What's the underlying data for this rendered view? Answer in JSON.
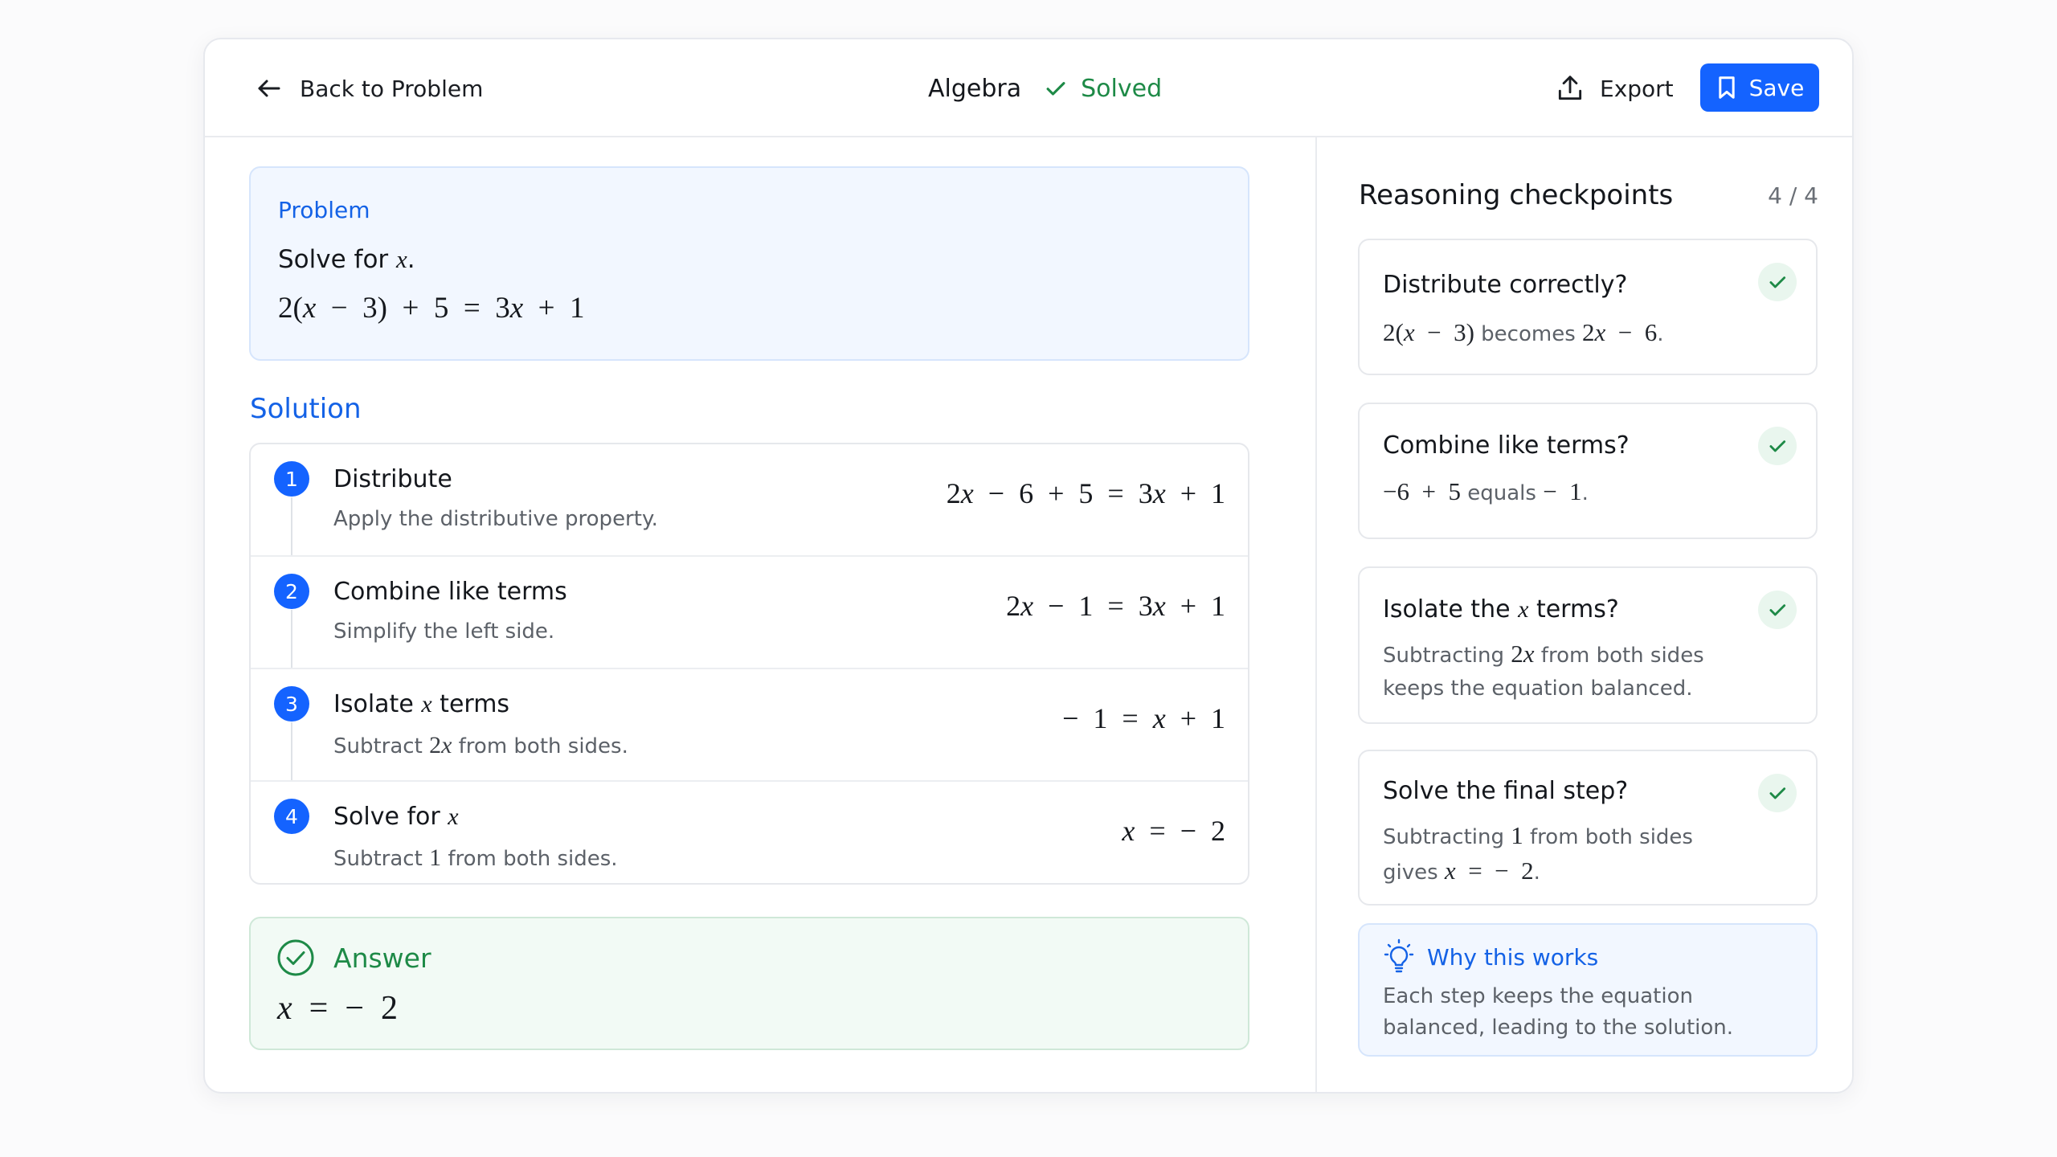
{
  "header": {
    "back_label": "Back to Problem",
    "subject": "Algebra",
    "status": "Solved",
    "export_label": "Export",
    "save_label": "Save"
  },
  "problem": {
    "label": "Problem",
    "instruction_prefix": "Solve for ",
    "instruction_var": "x",
    "instruction_suffix": ".",
    "equation": "2(x − 3) + 5 = 3x + 1"
  },
  "solution": {
    "heading": "Solution",
    "steps": [
      {
        "number": "1",
        "title": "Distribute",
        "description": "Apply the distributive property.",
        "equation": "2x − 6 + 5 = 3x + 1"
      },
      {
        "number": "2",
        "title": "Combine like terms",
        "description": "Simplify the left side.",
        "equation": "2x − 1 = 3x + 1"
      },
      {
        "number": "3",
        "title_prefix": "Isolate ",
        "title_var": "x",
        "title_suffix": " terms",
        "desc_prefix": "Subtract ",
        "desc_math": "2x",
        "desc_suffix": " from both sides.",
        "equation": "− 1 = x + 1"
      },
      {
        "number": "4",
        "title_prefix": "Solve for ",
        "title_var": "x",
        "desc_prefix": "Subtract ",
        "desc_math": "1",
        "desc_suffix": " from both sides.",
        "equation": "x = − 2"
      }
    ]
  },
  "answer": {
    "label": "Answer",
    "equation": "x = − 2"
  },
  "checkpoints": {
    "title": "Reasoning checkpoints",
    "count": "4 / 4",
    "items": [
      {
        "title": "Distribute correctly?",
        "math1": "2(x − 3)",
        "text1": " becomes ",
        "math2": "2x − 6",
        "text2": "."
      },
      {
        "title": "Combine like terms?",
        "math1": "−6 + 5",
        "text1": " equals ",
        "math2": "− 1",
        "text2": "."
      },
      {
        "title_prefix": "Isolate the ",
        "title_var": "x",
        "title_suffix": " terms?",
        "text0": "Subtracting ",
        "math1": "2x",
        "text1": " from both sides keeps the equation balanced."
      },
      {
        "title": "Solve the final step?",
        "text0": "Subtracting ",
        "math1": "1",
        "text1": " from both sides gives ",
        "math2": "x = − 2",
        "text2": "."
      }
    ]
  },
  "why": {
    "title": "Why this works",
    "description": "Each step keeps the equation balanced, leading to the solution."
  },
  "colors": {
    "accent": "#1463ff",
    "success": "#1e8a47",
    "text": "#14171c",
    "muted": "#5c6168"
  }
}
